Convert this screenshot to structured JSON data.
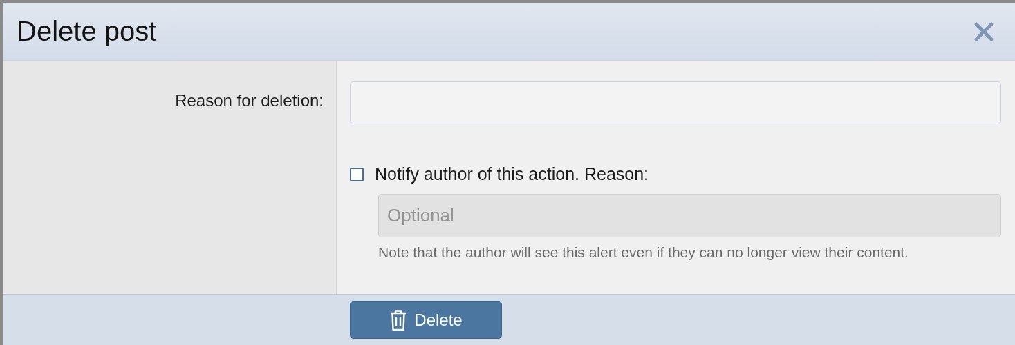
{
  "dialog": {
    "title": "Delete post"
  },
  "form": {
    "reason_label": "Reason for deletion:",
    "notify": {
      "label": "Notify author of this action. Reason:",
      "checked": false
    },
    "notify_reason": {
      "placeholder": "Optional",
      "disabled": true
    },
    "note": "Note that the author will see this alert even if they can no longer view their content."
  },
  "buttons": [
    {
      "label": "Delete",
      "kind": "delete"
    }
  ]
}
